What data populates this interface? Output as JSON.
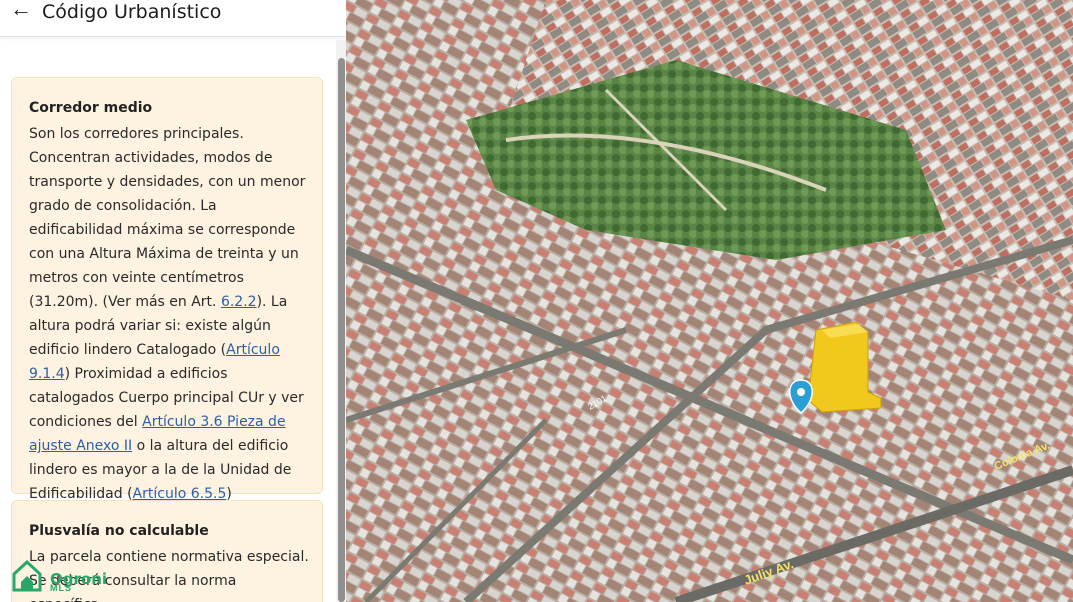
{
  "header": {
    "title": "Código Urbanístico",
    "back_icon": "arrow-left-icon"
  },
  "card1": {
    "heading": "Corredor medio",
    "text1": "Son los corredores principales. Concentran actividades, modos de transporte y densidades, con un menor grado de consolidación. La edificabilidad máxima se corresponde con una Altura Máxima de treinta y un metros con veinte centímetros (31.20m). (Ver más en Art. ",
    "link1": "6.2.2",
    "text2": "). La altura podrá variar si: existe algún edificio lindero Catalogado (",
    "link2": "Artículo 9.1.4",
    "text3": ") Proximidad a edificios catalogados Cuerpo principal CUr y ver condiciones del ",
    "link3": "Artículo 3.6 Pieza de ajuste Anexo II",
    "text4": " o la altura del edificio lindero es mayor a la de la Unidad de Edificabilidad (",
    "link4": "Artículo 6.5.5",
    "text5": ")"
  },
  "card2": {
    "heading": "Plusvalía no calculable",
    "text": "La parcela contiene normativa especial. Se deberá consultar la norma específica."
  },
  "watermark": {
    "brand": "Ogroni",
    "sub": "MLS",
    "icon": "house-logo-icon"
  },
  "map": {
    "street_labels": [
      "Juliy Av.",
      "Colonia Av.",
      "2101"
    ],
    "marker_icon": "location-pin-icon",
    "colors": {
      "building": "#f2c81c",
      "marker": "#2a9fd6",
      "trees": "#4d7a3c"
    }
  }
}
